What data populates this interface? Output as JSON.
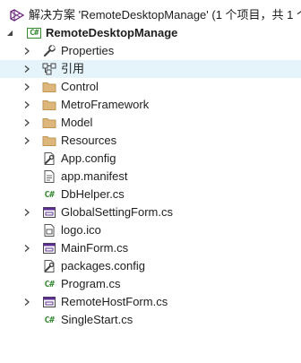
{
  "solution": {
    "label": "解决方案 'RemoteDesktopManage' (1 个项目，共 1 个"
  },
  "project": {
    "name": "RemoteDesktopManage",
    "project_icon_text": "C#",
    "expanded": true
  },
  "items": [
    {
      "label": "Properties",
      "icon": "wrench-icon",
      "expander": "collapsed"
    },
    {
      "label": "引用",
      "icon": "references-icon",
      "expander": "collapsed",
      "selected": true
    },
    {
      "label": "Control",
      "icon": "folder-icon",
      "expander": "collapsed"
    },
    {
      "label": "MetroFramework",
      "icon": "folder-icon",
      "expander": "collapsed"
    },
    {
      "label": "Model",
      "icon": "folder-icon",
      "expander": "collapsed"
    },
    {
      "label": "Resources",
      "icon": "folder-icon",
      "expander": "collapsed"
    },
    {
      "label": "App.config",
      "icon": "config-file-icon",
      "expander": "none"
    },
    {
      "label": "app.manifest",
      "icon": "manifest-file-icon",
      "expander": "none"
    },
    {
      "label": "DbHelper.cs",
      "icon": "csharp-file-icon",
      "icon_text": "C#",
      "expander": "none"
    },
    {
      "label": "GlobalSettingForm.cs",
      "icon": "form-icon",
      "expander": "collapsed"
    },
    {
      "label": "logo.ico",
      "icon": "icon-file-icon",
      "expander": "none"
    },
    {
      "label": "MainForm.cs",
      "icon": "form-icon",
      "expander": "collapsed"
    },
    {
      "label": "packages.config",
      "icon": "config-file-icon",
      "expander": "none"
    },
    {
      "label": "Program.cs",
      "icon": "csharp-file-icon",
      "icon_text": "C#",
      "expander": "none"
    },
    {
      "label": "RemoteHostForm.cs",
      "icon": "form-icon",
      "expander": "collapsed"
    },
    {
      "label": "SingleStart.cs",
      "icon": "csharp-file-icon",
      "icon_text": "C#",
      "expander": "none"
    }
  ],
  "colors": {
    "selection": "#e5f3fb",
    "folder": "#dcb67a",
    "csharp": "#388a34",
    "form": "#5c2d91",
    "text": "#1e1e1e",
    "expander": "#444444"
  }
}
